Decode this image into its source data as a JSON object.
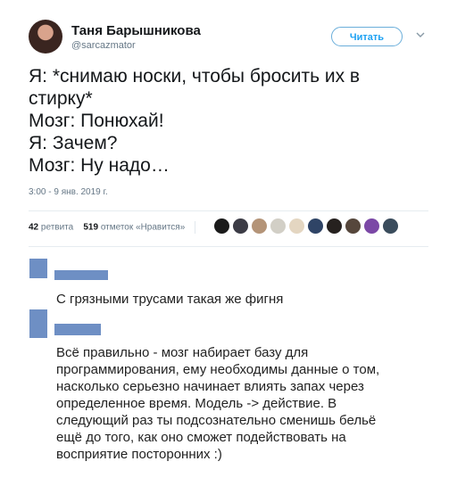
{
  "tweet": {
    "author_name": "Таня Барышникова",
    "author_handle": "@sarcazmator",
    "follow_label": "Читать",
    "text_lines": [
      "Я: *снимаю носки, чтобы бросить их в",
      "стирку*",
      "Мозг: Понюхай!",
      "Я: Зачем?",
      "Мозг: Ну надо…"
    ],
    "timestamp": "3:00 - 9 янв. 2019 г.",
    "retweets_count": "42",
    "retweets_label": "ретвита",
    "likes_count": "519",
    "likes_label": "отметок «Нравится»"
  },
  "comments": [
    {
      "text_lines": [
        "С грязными трусами такая же фигня"
      ]
    },
    {
      "text_lines": [
        "Всё правильно - мозг набирает базу для",
        "программирования, ему необходимы данные о том,",
        "насколько серьезно начинает влиять запах через",
        "определенное время. Модель -> действие. В",
        "следующий раз ты подсознательно сменишь бельё",
        "ещё до того, как оно сможет подействовать на",
        "восприятие посторонних :)"
      ]
    }
  ],
  "colors": {
    "accent": "#1da1f2",
    "censor_block": "#6e8fc4",
    "text": "#14171a",
    "muted": "#657786"
  },
  "icons": [
    "chevron-down-icon"
  ]
}
